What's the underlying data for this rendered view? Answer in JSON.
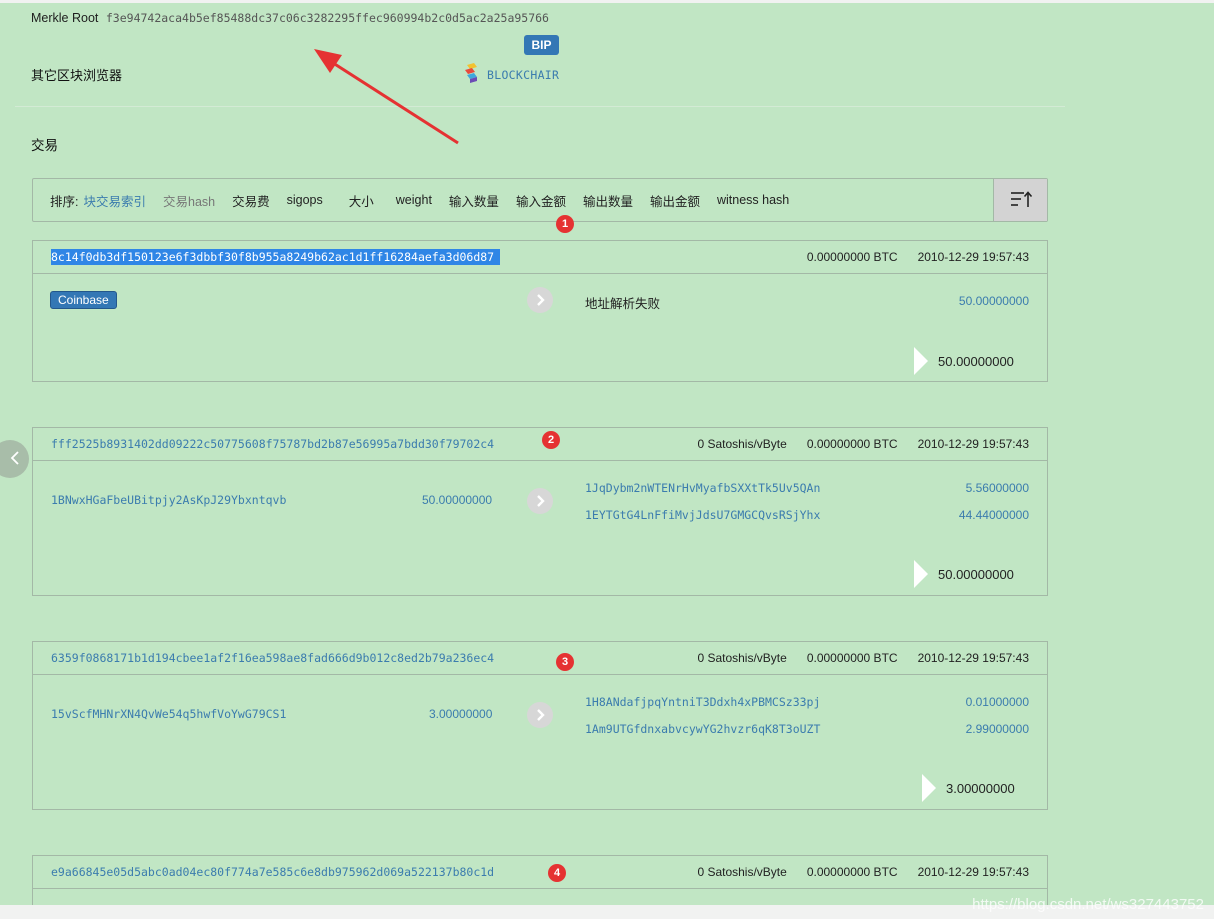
{
  "header": {
    "merkle_label": "Merkle Root",
    "merkle_value": "f3e94742aca4b5ef85488dc37c06c3282295ffec960994b2c0d5ac2a25a95766",
    "explorer_label": "其它区块浏览器",
    "bip_badge": "BIP",
    "blockchair_label": "BLOCKCHAIR"
  },
  "section_title": "交易",
  "sort_bar": {
    "label": "排序:",
    "items": [
      "块交易索引",
      "交易hash",
      "交易费",
      "sigops",
      "大小",
      "weight",
      "输入数量",
      "输入金额",
      "输出数量",
      "输出金额",
      "witness hash"
    ],
    "active_index": 0
  },
  "transactions": [
    {
      "badge": "1",
      "hash": "8c14f0db3df150123e6f3dbbf30f8b955a8249b62ac1d1ff16284aefa3d06d87",
      "fee_rate": "",
      "amount": "0.00000000 BTC",
      "time": "2010-12-29 19:57:43",
      "coinbase_label": "Coinbase",
      "output_fail": "地址解析失败",
      "output_amount": "50.00000000",
      "total": "50.00000000"
    },
    {
      "badge": "2",
      "hash": "fff2525b8931402dd09222c50775608f75787bd2b87e56995a7bdd30f79702c4",
      "fee_rate": "0 Satoshis/vByte",
      "amount": "0.00000000 BTC",
      "time": "2010-12-29 19:57:43",
      "input_address": "1BNwxHGaFbeUBitpjy2AsKpJ29Ybxntqvb",
      "input_amount": "50.00000000",
      "outputs": [
        {
          "address": "1JqDybm2nWTENrHvMyafbSXXtTk5Uv5QAn",
          "amount": "5.56000000"
        },
        {
          "address": "1EYTGtG4LnFfiMvjJdsU7GMGCQvsRSjYhx",
          "amount": "44.44000000"
        }
      ],
      "total": "50.00000000"
    },
    {
      "badge": "3",
      "hash": "6359f0868171b1d194cbee1af2f16ea598ae8fad666d9b012c8ed2b79a236ec4",
      "fee_rate": "0 Satoshis/vByte",
      "amount": "0.00000000 BTC",
      "time": "2010-12-29 19:57:43",
      "input_address": "15vScfMHNrXN4QvWe54q5hwfVoYwG79CS1",
      "input_amount": "3.00000000",
      "outputs": [
        {
          "address": "1H8ANdafjpqYntniT3Ddxh4xPBMCSz33pj",
          "amount": "0.01000000"
        },
        {
          "address": "1Am9UTGfdnxabvcywYG2hvzr6qK8T3oUZT",
          "amount": "2.99000000"
        }
      ],
      "total": "3.00000000"
    },
    {
      "badge": "4",
      "hash": "e9a66845e05d5abc0ad04ec80f774a7e585c6e8db975962d069a522137b80c1d",
      "fee_rate": "0 Satoshis/vByte",
      "amount": "0.00000000 BTC",
      "time": "2010-12-29 19:57:43"
    }
  ],
  "watermark": "https://blog.csdn.net/ws327443752",
  "colors": {
    "page_bg": "#c1e6c4",
    "link": "#3b7cae",
    "badge_blue": "#3377b5",
    "annotation_red": "#e53232"
  }
}
